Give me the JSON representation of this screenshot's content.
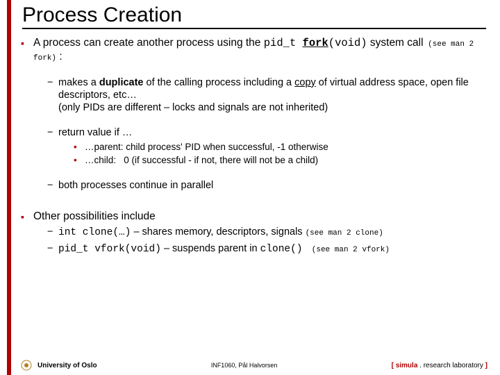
{
  "title": "Process Creation",
  "b1": {
    "pre": "A process can create another process using the ",
    "code": "pid_t ",
    "code_u": "fork",
    "code2": "(void)",
    "mid": " system call",
    "note": " (see man 2 fork)",
    "post": " :",
    "s1": {
      "a": "makes a ",
      "b": "duplicate",
      "c": " of the calling process including a ",
      "d": "copy",
      "e": " of virtual address space, open file descriptors, etc…",
      "f": "(only PIDs are different – locks and signals are not inherited)"
    },
    "s2": "return value if …",
    "s2a": "…parent: child process' PID when successful, -1 otherwise",
    "s2b_pre": "…child:   ",
    "s2b_post": "0  (if successful - if not, there will not be a child)",
    "s3": "both processes continue in parallel"
  },
  "b2": {
    "lead": "Other possibilities include",
    "s1_code": "int clone(…)",
    "s1_text": " – shares memory, descriptors, signals ",
    "s1_note": "(see man 2 clone)",
    "s2_code": "pid_t vfork(void)",
    "s2_text": " – suspends parent in ",
    "s2_code2": "clone()",
    "s2_note": "  (see man 2 vfork)"
  },
  "footer": {
    "uni": "University of Oslo",
    "center": "INF1060, Pål Halvorsen",
    "right_bracket_l": "[ ",
    "right_sim": "simula",
    "right_rl": " . research laboratory",
    "right_bracket_r": " ]"
  }
}
